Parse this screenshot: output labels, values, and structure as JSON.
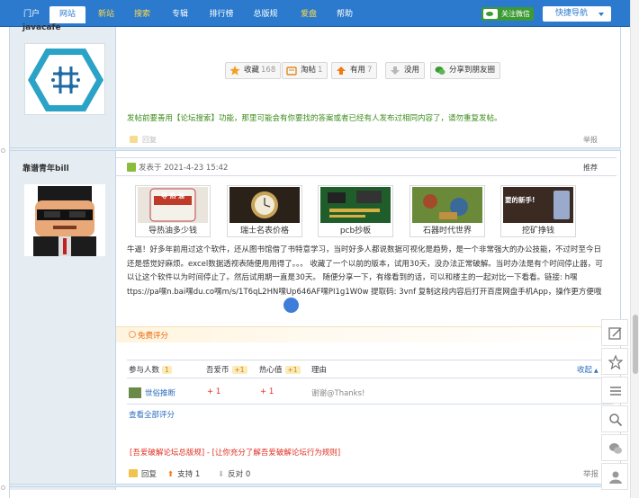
{
  "nav": {
    "items": [
      {
        "label": "门户",
        "x": 0
      },
      {
        "label": "网站",
        "active": true
      },
      {
        "label": "新站",
        "yellow": true
      },
      {
        "label": "搜索",
        "yellow": true
      },
      {
        "label": "专辑"
      },
      {
        "label": "排行榜"
      },
      {
        "label": "总版规"
      },
      {
        "label": "爱盘",
        "yellow": true
      },
      {
        "label": "帮助"
      }
    ],
    "wechat_label": "关注微信",
    "quicknav_label": "快捷导航"
  },
  "post1": {
    "author": "javacafe",
    "actions": {
      "favorite": {
        "label": "收藏",
        "count": "168"
      },
      "tao": {
        "label": "淘帖",
        "count": "1"
      },
      "useful": {
        "label": "有用",
        "count": "7"
      },
      "useless": {
        "label": "没用"
      },
      "share": {
        "label": "分享到朋友圈"
      }
    },
    "notice": "发帖前要善用【论坛搜索】功能，那里可能会有你要找的答案或者已经有人发布过相同内容了，请勿重复发帖。",
    "reply": "回复",
    "report": "举报"
  },
  "post2": {
    "author": "靠谱青年bill",
    "posted": "发表于 2021-4-23 15:42",
    "recommend": "推荐",
    "cards": [
      {
        "caption": "导热油多少钱",
        "pic": "导 热 油"
      },
      {
        "caption": "瑞士名表价格"
      },
      {
        "caption": "pcb抄板"
      },
      {
        "caption": "石器时代世界"
      },
      {
        "caption": "挖矿挣钱",
        "pic": "要的新手!"
      }
    ],
    "body": "牛逼！好多年前用过这个软件，还从图书馆借了书特意学习，当时好多人都说数据可视化是趋势，是一个非常强大的办公技能，不过时至今日还是感觉好麻烦。excel数据透视表随便用用得了。。。 收藏了一个以前的版本，试用30天，没办法正常破解。当时办法是有个时间停止器，可以让这个软件以为时间停止了。然后试用期一直是30天。 随便分享一下，有缘看到的话，可以和楼主的一起对比一下看看。链接: h嘿ttps://pa嘿n.bai嘿du.co嘿m/s/1T6qL2HN嘿Up646AF嘿PI1g1W0w 提取码: 3vnf 复制这段内容后打开百度网盘手机App，操作更方便哦",
    "rate_label": "免费评分",
    "rate_table": {
      "headers": {
        "participants": "参与人数",
        "participants_count": "1",
        "coin": "吾爱币",
        "coin_val": "+1",
        "heat": "热心值",
        "heat_val": "+1",
        "reason": "理由"
      },
      "collapse": "收起",
      "rows": [
        {
          "user": "世俗推断",
          "coin": "+ 1",
          "heat": "+ 1",
          "reason": "谢谢@Thanks!"
        }
      ],
      "view_all": "查看全部评分"
    },
    "rules": "[吾爱破解论坛总版规] - [让你充分了解吾爱破解论坛行为规则]",
    "footer": {
      "reply": "回复",
      "support": "支持",
      "support_count": "1",
      "oppose": "反对",
      "oppose_count": "0",
      "report": "举报"
    }
  },
  "colors": {
    "nav": "#2b7acd",
    "sidebar": "#e5edf2",
    "notice": "#3c8c1c",
    "rules": "#e03020"
  }
}
